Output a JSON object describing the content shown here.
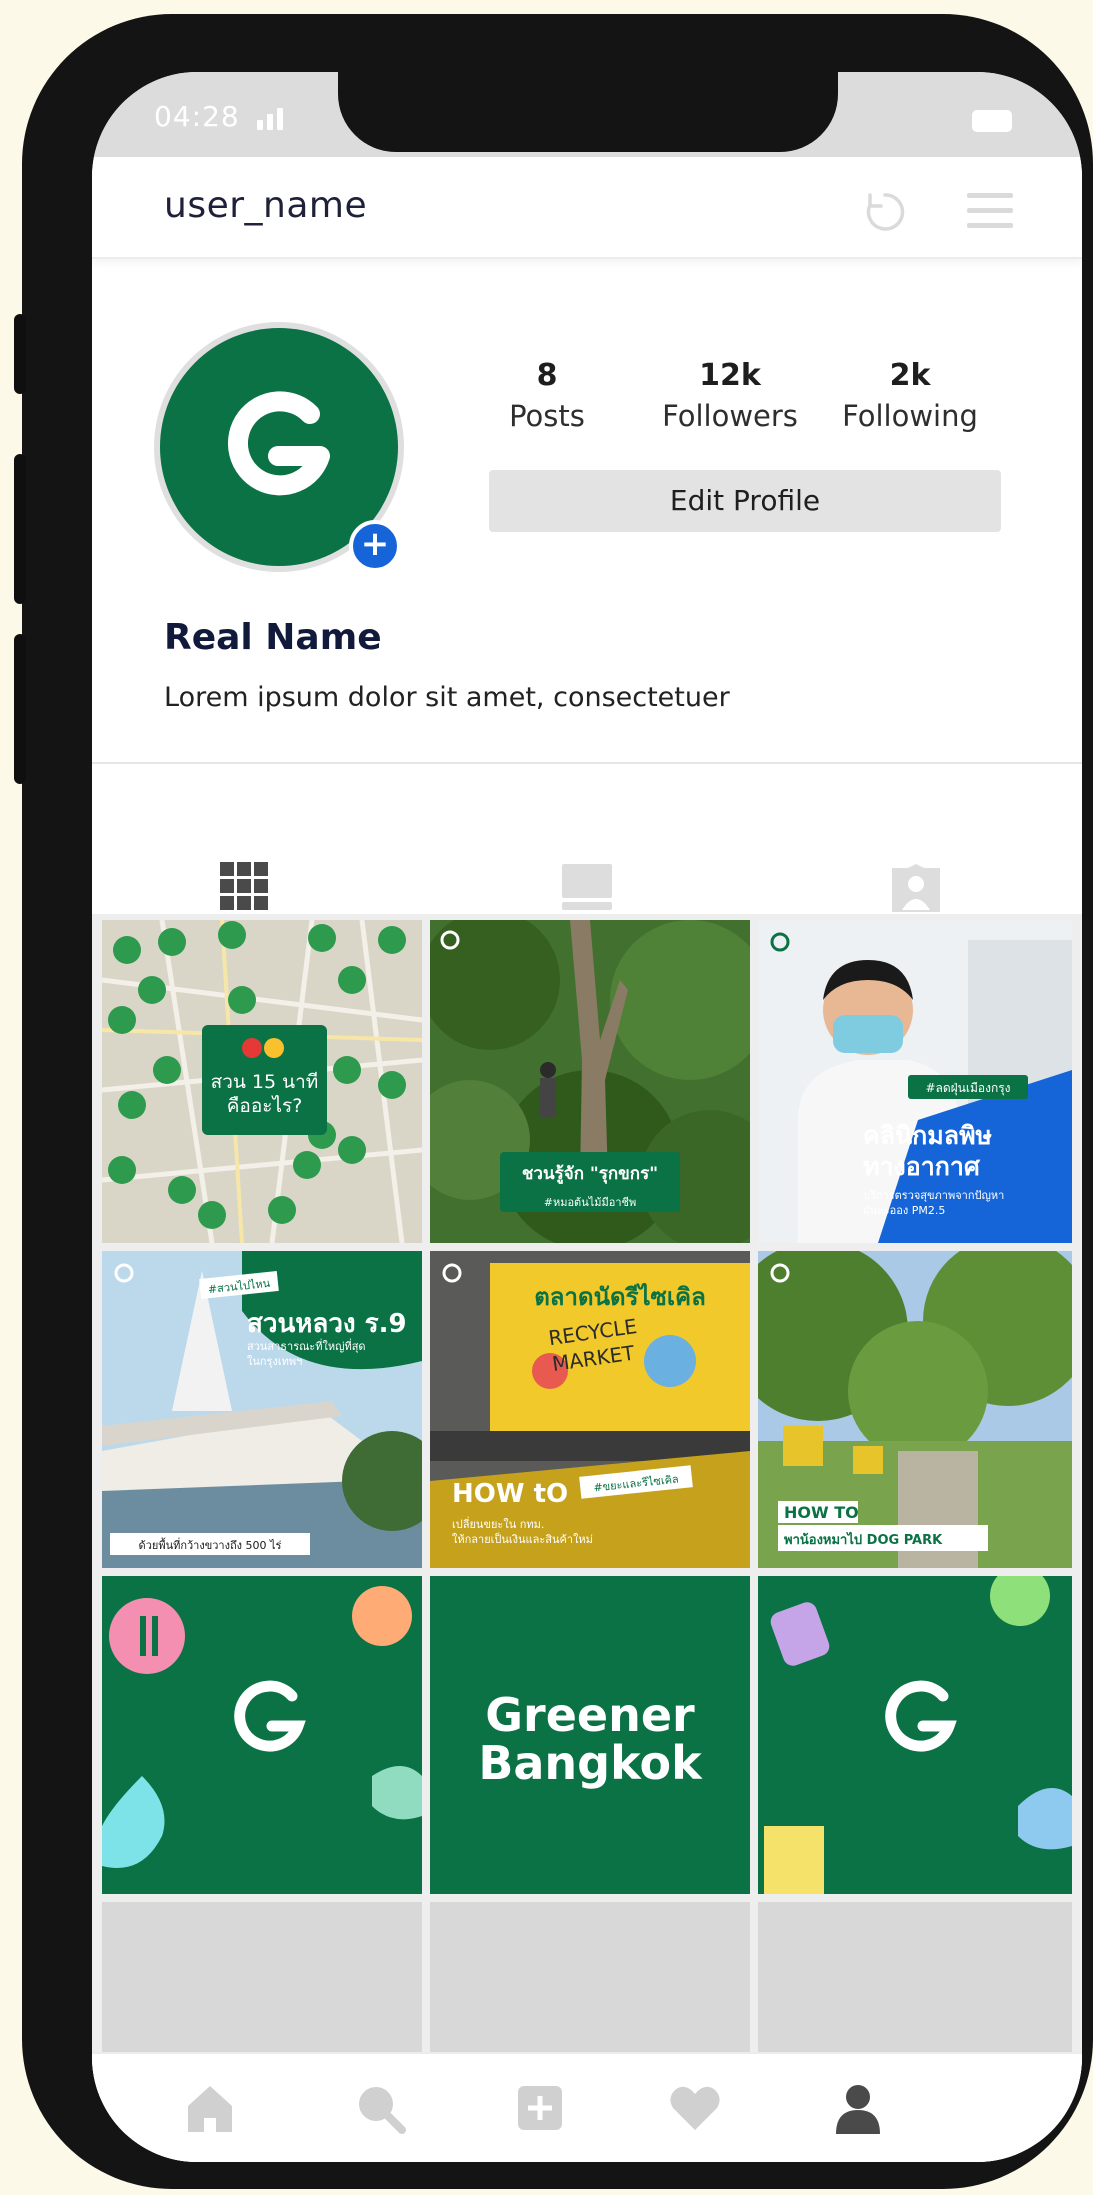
{
  "status": {
    "time": "04:28"
  },
  "header": {
    "username": "user_name"
  },
  "profile": {
    "avatar_letter": "G",
    "real_name": "Real Name",
    "bio": "Lorem ipsum dolor sit amet, consectetuer",
    "add_badge": "+",
    "stats": [
      {
        "value": "8",
        "label": "Posts"
      },
      {
        "value": "12k",
        "label": "Followers"
      },
      {
        "value": "2k",
        "label": "Following"
      }
    ],
    "edit_label": "Edit Profile"
  },
  "tabs": [
    {
      "icon": "grid-icon",
      "active": true
    },
    {
      "icon": "video-icon",
      "active": false
    },
    {
      "icon": "tagged-icon",
      "active": false
    }
  ],
  "posts": [
    {
      "kind": "map",
      "badge": "15",
      "text_line1": "สวน 15 นาที",
      "text_line2": "คืออะไร?"
    },
    {
      "kind": "photo",
      "label_line1": "ชวนรู้จัก \"รุกขกร\"",
      "label_line2": "#หมอต้นไม้มีอาชีพ"
    },
    {
      "kind": "photo",
      "tag": "#ลดฝุ่นเมืองกรุง",
      "title_line1": "คลินิกมลพิษ",
      "title_line2": "ทางอากาศ",
      "sub_line1": "บริการตรวจสุขภาพจากปัญหา",
      "sub_line2": "ฝุ่นละออง PM2.5"
    },
    {
      "kind": "photo",
      "tag": "#สวนไปไหน",
      "title": "สวนหลวง ร.9",
      "sub_line1": "สวนสาธารณะที่ใหญ่ที่สุด",
      "sub_line2": "ในกรุงเทพฯ",
      "caption": "ด้วยพื้นที่กว้างขวางถึง 500 ไร่"
    },
    {
      "kind": "photo",
      "banner_top": "ตลาดนัดรีไซเคิล",
      "banner_sub1": "RECYCLE",
      "banner_sub2": "MARKET",
      "tag": "#ขยะและรีไซเคิล",
      "title": "HOW tO",
      "sub_line1": "เปลี่ยนขยะใน กทม.",
      "sub_line2": "ให้กลายเป็นเงินและสินค้าใหม่"
    },
    {
      "kind": "photo",
      "title_line1": "HOW TO",
      "title_line2": "พาน้องหมาไป DOG PARK"
    },
    {
      "kind": "icon-tile",
      "letter": "G"
    },
    {
      "kind": "brand-tile",
      "line1": "Greener",
      "line2": "Bangkok"
    },
    {
      "kind": "icon-tile",
      "letter": "G"
    }
  ],
  "bottom_nav": [
    "home-icon",
    "search-icon",
    "add-post-icon",
    "heart-icon",
    "profile-icon"
  ],
  "colors": {
    "brand_green": "#0a7244",
    "accent_blue": "#1565d8",
    "frame": "#141414"
  }
}
